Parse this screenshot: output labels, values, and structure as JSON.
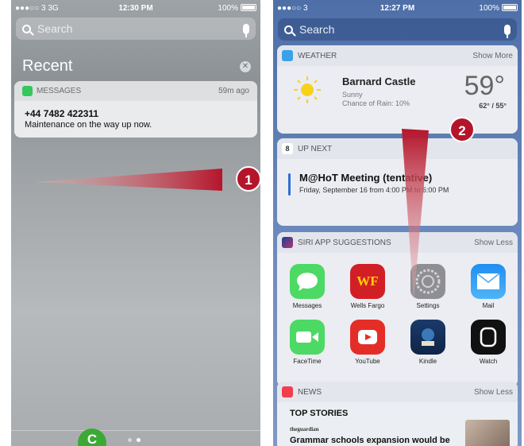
{
  "left": {
    "status": {
      "carrier": "●●●○○ 3 3G",
      "time": "12:30 PM",
      "battery": "100%"
    },
    "search_placeholder": "Search",
    "recent_title": "Recent",
    "notification": {
      "app": "MESSAGES",
      "time_ago": "59m ago",
      "sender": "+44 7482 422311",
      "text": "Maintenance on the way up now."
    },
    "camera_badge": "C"
  },
  "right": {
    "status": {
      "carrier": "●●●○○ 3",
      "time": "12:27 PM",
      "battery": "100%"
    },
    "search_placeholder": "Search",
    "weather": {
      "header": "WEATHER",
      "action": "Show More",
      "city": "Barnard Castle",
      "condition": "Sunny",
      "rain": "Chance of Rain: 10%",
      "temp": "59°",
      "hilo": "62° / 55°"
    },
    "upnext": {
      "header": "UP NEXT",
      "day_number": "8",
      "event_title": "M@HoT Meeting (tentative)",
      "event_time": "Friday, September 16 from 4:00 PM to 6:00 PM"
    },
    "siri": {
      "header": "SIRI APP SUGGESTIONS",
      "action": "Show Less",
      "apps": [
        "Messages",
        "Wells Fargo",
        "Settings",
        "Mail",
        "FaceTime",
        "YouTube",
        "Kindle",
        "Watch"
      ],
      "wf_text": "WF"
    },
    "news": {
      "header": "NEWS",
      "action": "Show Less",
      "section": "TOP STORIES",
      "source": "theguardian",
      "headline": "Grammar schools expansion would be"
    }
  },
  "callouts": {
    "one": "1",
    "two": "2"
  },
  "colors": {
    "callout": "#b5152b",
    "badge": "#3aaa35",
    "right_bg": "#5e7db3"
  }
}
